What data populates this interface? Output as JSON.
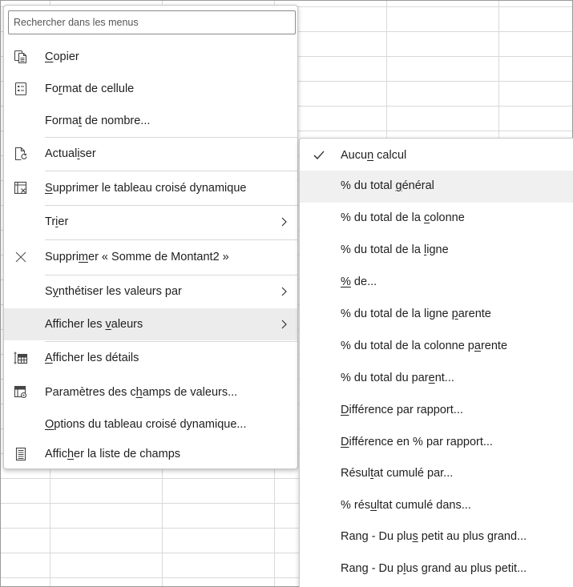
{
  "search": {
    "placeholder": "Rechercher dans les menus"
  },
  "menu": {
    "items": [
      {
        "pre": "",
        "u": "C",
        "post": "opier",
        "icon": "copy-icon"
      },
      {
        "pre": "Fo",
        "u": "r",
        "post": "mat de cellule",
        "icon": "format-cells-icon"
      },
      {
        "pre": "Forma",
        "u": "t",
        "post": " de nombre...",
        "icon": ""
      },
      {
        "pre": "Actual",
        "u": "i",
        "post": "ser",
        "icon": "refresh-icon"
      },
      {
        "pre": "",
        "u": "S",
        "post": "upprimer le tableau croisé dynamique",
        "icon": "delete-pivot-icon"
      },
      {
        "pre": "Tr",
        "u": "i",
        "post": "er",
        "icon": ""
      },
      {
        "pre": "Suppri",
        "u": "m",
        "post": "er « Somme de Montant2 »",
        "icon": "close-icon"
      },
      {
        "pre": "S",
        "u": "y",
        "post": "nthétiser les valeurs par",
        "icon": ""
      },
      {
        "pre": "Afficher les ",
        "u": "v",
        "post": "aleurs",
        "icon": ""
      },
      {
        "pre": "",
        "u": "A",
        "post": "fficher les détails",
        "icon": "show-details-icon"
      },
      {
        "pre": "Paramètres des c",
        "u": "h",
        "post": "amps de valeurs...",
        "icon": "field-settings-icon"
      },
      {
        "pre": "",
        "u": "O",
        "post": "ptions du tableau croisé dynamique...",
        "icon": ""
      },
      {
        "pre": "Affic",
        "u": "h",
        "post": "er la liste de champs",
        "icon": "field-list-icon"
      }
    ]
  },
  "submenu": {
    "items": [
      {
        "pre": "Aucu",
        "u": "n",
        "post": " calcul",
        "checked": true
      },
      {
        "pre": "% du total ",
        "u": "g",
        "post": "énéral"
      },
      {
        "pre": "% du total de la ",
        "u": "c",
        "post": "olonne"
      },
      {
        "pre": "% du total de la ",
        "u": "l",
        "post": "igne"
      },
      {
        "pre": "",
        "u": "%",
        "post": " de..."
      },
      {
        "pre": "% du total de la ligne ",
        "u": "p",
        "post": "arente"
      },
      {
        "pre": "% du total de la colonne p",
        "u": "a",
        "post": "rente"
      },
      {
        "pre": "% du total du par",
        "u": "e",
        "post": "nt..."
      },
      {
        "pre": "",
        "u": "D",
        "post": "ifférence par rapport..."
      },
      {
        "pre": "",
        "u": "D",
        "post": "ifférence en % par rapport..."
      },
      {
        "pre": "Résul",
        "u": "t",
        "post": "at cumulé par..."
      },
      {
        "pre": "% rés",
        "u": "u",
        "post": "ltat cumulé dans..."
      },
      {
        "pre": "Rang - Du plu",
        "u": "s",
        "post": " petit au plus grand..."
      },
      {
        "pre": "Rang - Du p",
        "u": "l",
        "post": "us grand au plus petit..."
      }
    ]
  }
}
